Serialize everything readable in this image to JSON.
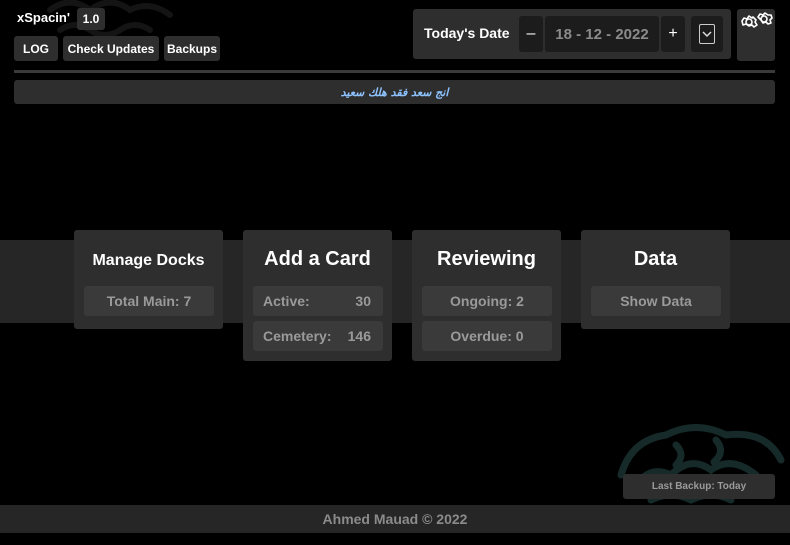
{
  "app": {
    "title": "xSpacin'",
    "version": "1.0"
  },
  "toolbar": {
    "log_label": "LOG",
    "check_updates_label": "Check Updates",
    "backups_label": "Backups"
  },
  "date_panel": {
    "label": "Today's Date",
    "minus_label": "–",
    "value": "18 - 12 - 2022",
    "plus_label": "+"
  },
  "quote": "انج سعد فقد هلك سعيد",
  "cards": {
    "manage_docks": {
      "title": "Manage Docks",
      "total_main": "Total Main: 7"
    },
    "add_card": {
      "title": "Add a Card",
      "active_label": "Active:",
      "active_value": "30",
      "cemetery_label": "Cemetery:",
      "cemetery_value": "146"
    },
    "reviewing": {
      "title": "Reviewing",
      "ongoing": "Ongoing: 2",
      "overdue": "Overdue: 0"
    },
    "data": {
      "title": "Data",
      "show_data_label": "Show Data"
    }
  },
  "status": {
    "last_backup": "Last Backup: Today"
  },
  "footer": {
    "text": "Ahmed Mauad © 2022"
  },
  "icons": {
    "settings": "gears-icon",
    "dropdown": "chevron-down-icon",
    "background": "brain-icon"
  },
  "colors": {
    "background": "#000000",
    "panel": "#2e2e2e",
    "accent_quote": "#8ec4ff"
  }
}
